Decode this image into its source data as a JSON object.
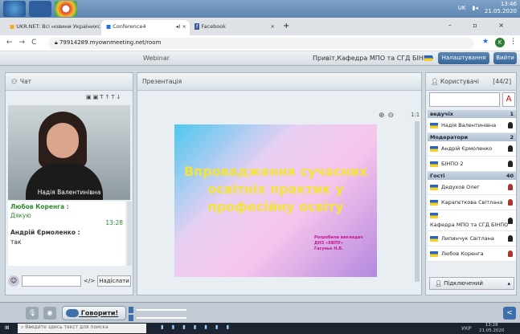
{
  "system": {
    "lang": "UK",
    "time": "13:46",
    "date": "21.05.2020"
  },
  "browser": {
    "tabs": [
      {
        "title": "UKR.NET: Всі новини України, с"
      },
      {
        "title": "Conference4"
      },
      {
        "title": "Facebook"
      }
    ],
    "url": "79914289.myownmeeting.net/room",
    "profile_initial": "K"
  },
  "app": {
    "title": "Webinar",
    "greeting": "Привіт,Кафедра МПО та СГД БІНПО",
    "settings_label": "Налаштування",
    "exit_label": "Вийти"
  },
  "chat": {
    "title": "Чат",
    "video_name": "Надія Валентинівна",
    "messages": [
      {
        "author": "Любов Коренга :",
        "text": "Дякую",
        "time": "13:28"
      },
      {
        "author": "Андрій Єрмоленко :",
        "text": "так",
        "time": ""
      }
    ],
    "send_label": "Надіслати",
    "input_placeholder": ""
  },
  "presentation": {
    "title": "Презентація",
    "zoom_text": "1:1",
    "slide_title": "Впровадження сучасних освітніх практик у професійну освіту",
    "slide_credit": [
      "Розробила викладач",
      "ДНЗ «ХВПУ»",
      "Гагуньо Н.В."
    ]
  },
  "users": {
    "title": "Користувачі",
    "count": "[44/2]",
    "groups": [
      {
        "name": "ведучіх",
        "count": "1",
        "items": [
          "Надія Валентинівна"
        ]
      },
      {
        "name": "Модератори",
        "count": "2",
        "items": [
          "Андрій Єрмоленко",
          "БІНПО 2"
        ]
      },
      {
        "name": "Гості",
        "count": "40",
        "items": [
          "Дедухов Олег",
          "Карапєткова Світлана",
          "Кафедра МПО та СГД БІНПО",
          "Липинчук Світлана",
          "Любов Коренга"
        ]
      }
    ],
    "connected_label": "Підключений"
  },
  "toolbar": {
    "talk_label": "Говорити!"
  },
  "taskbar": {
    "search_placeholder": "Введите здесь текст для поиска",
    "lang": "УКР",
    "time": "13:28",
    "date": "21.05.2020"
  }
}
